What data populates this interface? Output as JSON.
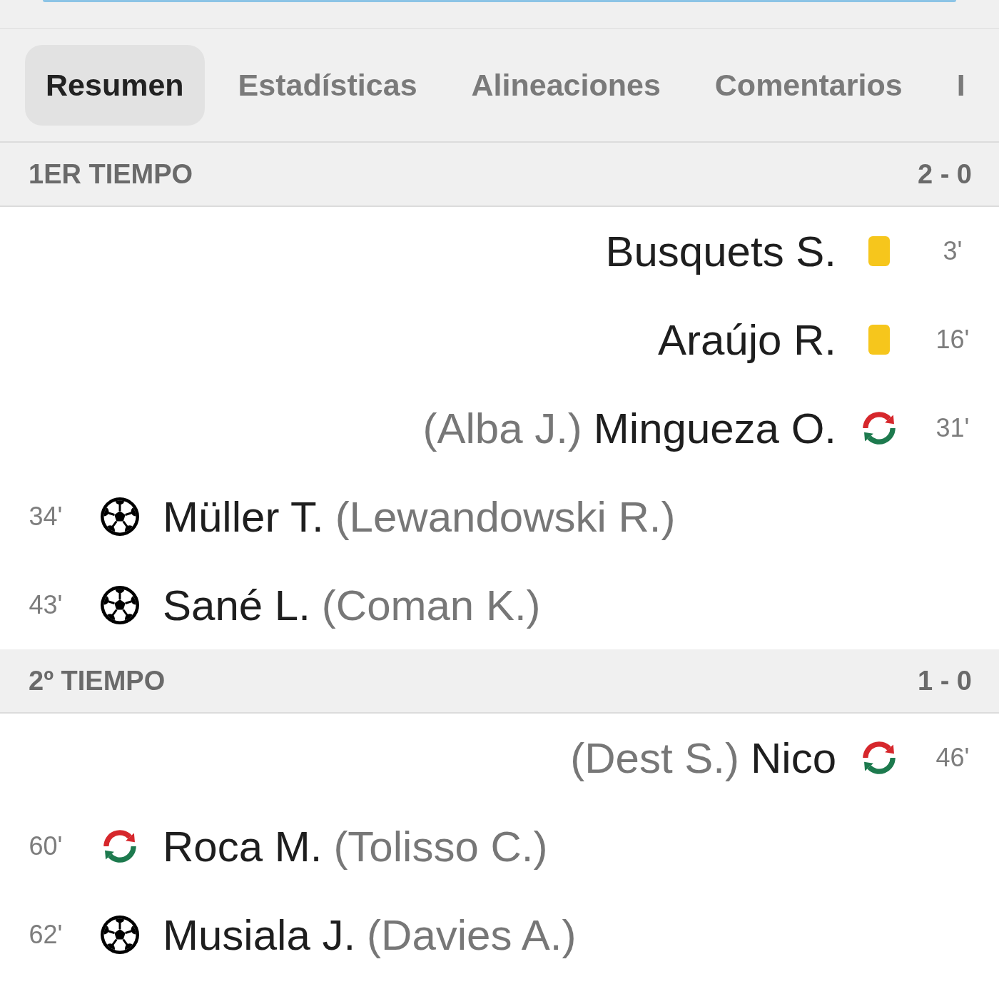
{
  "tabs": [
    {
      "label": "Resumen",
      "selected": true
    },
    {
      "label": "Estadísticas",
      "selected": false
    },
    {
      "label": "Alineaciones",
      "selected": false
    },
    {
      "label": "Comentarios",
      "selected": false
    },
    {
      "label": "I",
      "selected": false
    }
  ],
  "periods": [
    {
      "title": "1ER TIEMPO",
      "score": "2 - 0",
      "events": [
        {
          "away": {
            "kind": "yellow_card",
            "minute": "3'",
            "player": "Busquets S."
          }
        },
        {
          "away": {
            "kind": "yellow_card",
            "minute": "16'",
            "player": "Araújo R."
          }
        },
        {
          "away": {
            "kind": "substitution",
            "minute": "31'",
            "player": "Mingueza O.",
            "secondary": "(Alba J.)"
          }
        },
        {
          "home": {
            "kind": "goal",
            "minute": "34'",
            "player": "Müller T.",
            "secondary": "(Lewandowski R.)"
          }
        },
        {
          "home": {
            "kind": "goal",
            "minute": "43'",
            "player": "Sané L.",
            "secondary": "(Coman K.)"
          }
        }
      ]
    },
    {
      "title": "2º TIEMPO",
      "score": "1 - 0",
      "events": [
        {
          "away": {
            "kind": "substitution",
            "minute": "46'",
            "player": "Nico",
            "secondary": "(Dest S.)"
          }
        },
        {
          "home": {
            "kind": "substitution",
            "minute": "60'",
            "player": "Roca M.",
            "secondary": "(Tolisso C.)"
          }
        },
        {
          "home": {
            "kind": "goal",
            "minute": "62'",
            "player": "Musiala J.",
            "secondary": "(Davies A.)"
          }
        }
      ]
    }
  ]
}
